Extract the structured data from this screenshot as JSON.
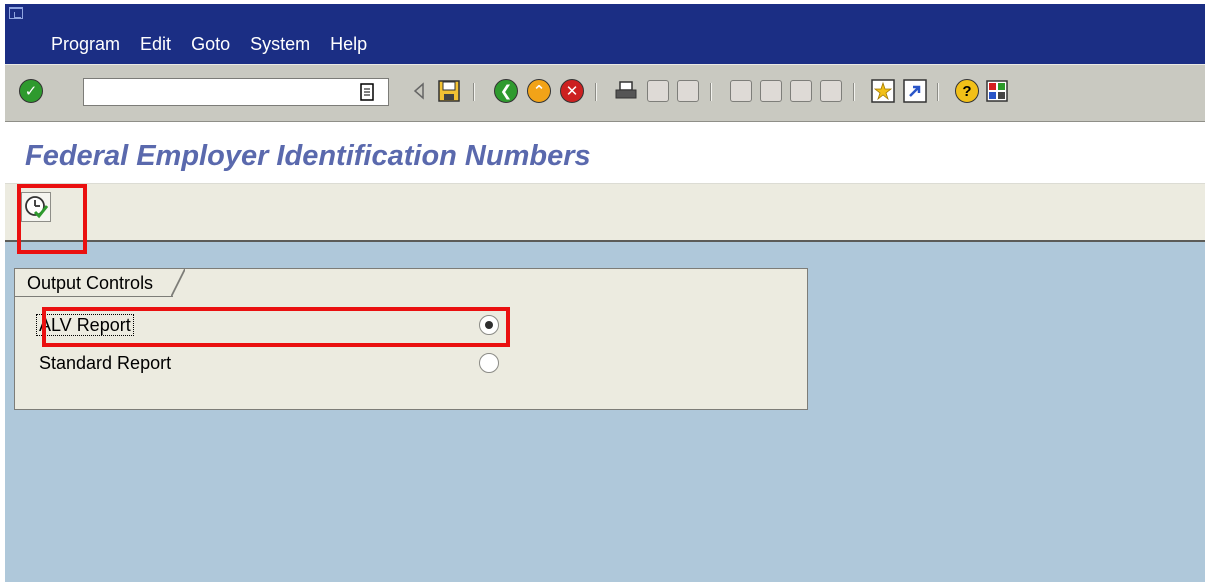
{
  "menu": {
    "items": [
      {
        "label": "Program"
      },
      {
        "label": "Edit"
      },
      {
        "label": "Goto"
      },
      {
        "label": "System"
      },
      {
        "label": "Help"
      }
    ]
  },
  "toolbar": {
    "command_value": "",
    "icons": [
      "enter-check-icon",
      "command-dropdown-icon",
      "save-icon",
      "back-icon",
      "exit-icon",
      "cancel-icon",
      "print-icon",
      "find-icon",
      "find-next-icon",
      "first-page-icon",
      "previous-page-icon",
      "next-page-icon",
      "last-page-icon",
      "create-session-icon",
      "shortcut-icon",
      "help-icon",
      "layout-menu-icon"
    ]
  },
  "title": "Federal Employer Identification Numbers",
  "app_toolbar": {
    "execute_icon": "execute-icon"
  },
  "output_controls": {
    "title": "Output Controls",
    "options": [
      {
        "label": "ALV Report",
        "selected": true
      },
      {
        "label": "Standard Report",
        "selected": false
      }
    ]
  },
  "colors": {
    "menubar": "#1b2e84",
    "title": "#5a69ad",
    "canvas": "#afc8da",
    "highlight": "#ea1010"
  }
}
